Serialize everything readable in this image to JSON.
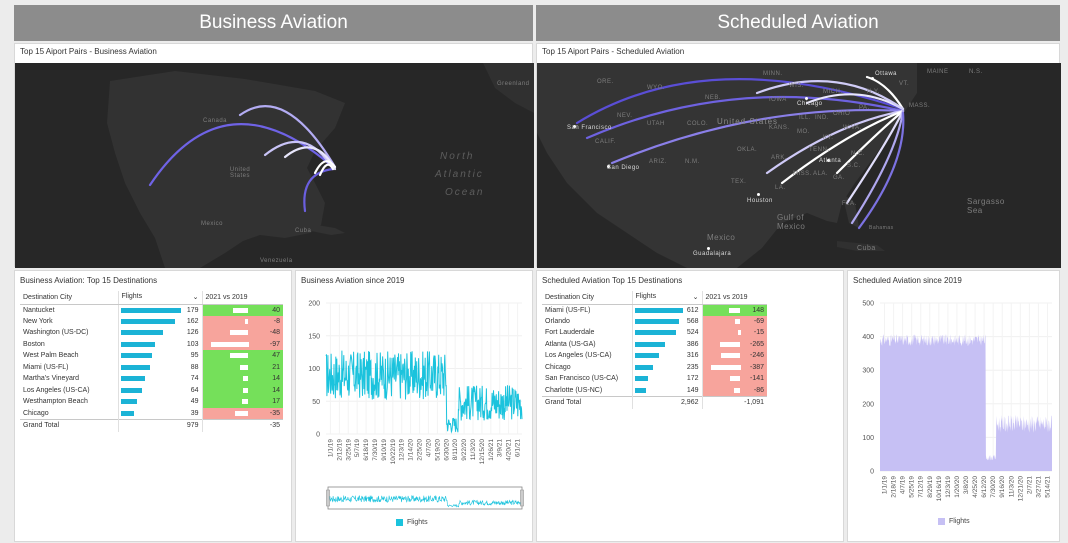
{
  "banners": {
    "left": "Business Aviation",
    "right": "Scheduled Aviation"
  },
  "maps": {
    "left": {
      "title": "Top 15 Aiport Pairs - Business Aviation",
      "labels": [
        "Canada",
        "United States",
        "Mexico",
        "Cuba",
        "North",
        "Atlantic",
        "Ocean",
        "Greenland",
        "Venezuela"
      ]
    },
    "right": {
      "title": "Top 15 Aiport Pairs - Scheduled Aviation",
      "labels": [
        "United States",
        "Mexico",
        "Gulf of Mexico",
        "Sargasso Sea",
        "Cuba",
        "Bahamas",
        "ORE.",
        "WYO.",
        "NEB.",
        "IOWA",
        "NEV.",
        "UTAH",
        "COLO.",
        "KANS.",
        "MO.",
        "CALIF.",
        "ARIZ.",
        "N.M.",
        "OKLA.",
        "ARK.",
        "TEX.",
        "LA.",
        "MISS.",
        "ALA.",
        "GA.",
        "S.C.",
        "N.C.",
        "TENN.",
        "KY.",
        "W.VA.",
        "OHIO",
        "IND.",
        "ILL.",
        "PA.",
        "N.Y.",
        "MAINE",
        "MASS.",
        "N.S.",
        "VT.",
        "MICH.",
        "WIS.",
        "MINN.",
        "FLA."
      ],
      "cities": [
        "Ottawa",
        "Chicago",
        "San Francisco",
        "San Diego",
        "Atlanta",
        "Houston",
        "Guadalajara"
      ]
    }
  },
  "business_table": {
    "title": "Business Aviation: Top 15 Destinations",
    "headers": [
      "Destination City",
      "Flights",
      "2021 vs 2019"
    ],
    "sort_icon": "chevron-down-icon",
    "rows": [
      {
        "city": "Nantucket",
        "flights": 179,
        "vs": 40
      },
      {
        "city": "New York",
        "flights": 162,
        "vs": -8
      },
      {
        "city": "Washington (US-DC)",
        "flights": 126,
        "vs": -48
      },
      {
        "city": "Boston",
        "flights": 103,
        "vs": -97
      },
      {
        "city": "West Palm Beach",
        "flights": 95,
        "vs": 47
      },
      {
        "city": "Miami (US-FL)",
        "flights": 88,
        "vs": 21
      },
      {
        "city": "Martha's Vineyard",
        "flights": 74,
        "vs": 14
      },
      {
        "city": "Los Angeles (US-CA)",
        "flights": 64,
        "vs": 14
      },
      {
        "city": "Westhampton Beach",
        "flights": 49,
        "vs": 17
      },
      {
        "city": "Chicago",
        "flights": 39,
        "vs": -35
      }
    ],
    "total_label": "Grand Total",
    "total_flights": 979,
    "total_vs": -35
  },
  "scheduled_table": {
    "title": "Scheduled Aviation Top 15 Destinations",
    "headers": [
      "Destination City",
      "Flights",
      "2021 vs 2019"
    ],
    "sort_icon": "chevron-down-icon",
    "rows": [
      {
        "city": "Miami (US-FL)",
        "flights": 612,
        "vs": 148
      },
      {
        "city": "Orlando",
        "flights": 568,
        "vs": -69
      },
      {
        "city": "Fort Lauderdale",
        "flights": 524,
        "vs": -15
      },
      {
        "city": "Atlanta (US-GA)",
        "flights": 386,
        "vs": -265
      },
      {
        "city": "Los Angeles (US-CA)",
        "flights": 316,
        "vs": -246
      },
      {
        "city": "Chicago",
        "flights": 235,
        "vs": -387
      },
      {
        "city": "San Francisco (US-CA)",
        "flights": 172,
        "vs": -141
      },
      {
        "city": "Charlotte (US-NC)",
        "flights": 149,
        "vs": -86
      }
    ],
    "total_label": "Grand Total",
    "total_flights": "2,962",
    "total_vs": "-1,091"
  },
  "colors": {
    "business": "#1bc3dd",
    "scheduled": "#c6c0f4",
    "positive": "#75e05a",
    "negative": "#f7a49c"
  },
  "chart_data": [
    {
      "type": "line",
      "title": "Business Aviation since 2019",
      "ylim": [
        0,
        200
      ],
      "yticks": [
        0,
        50,
        100,
        150,
        200
      ],
      "x_ticks": [
        "1/1/19",
        "2/12/19",
        "3/25/19",
        "5/7/19",
        "6/18/19",
        "7/30/19",
        "9/10/19",
        "10/22/19",
        "12/3/19",
        "1/14/20",
        "2/25/20",
        "4/7/20",
        "5/19/20",
        "6/30/20",
        "8/11/20",
        "9/22/20",
        "11/3/20",
        "12/15/20",
        "1/26/21",
        "3/9/21",
        "4/20/21",
        "6/1/21"
      ],
      "series": [
        {
          "name": "Flights",
          "segments": [
            {
              "x_range": [
                "1/1/19",
                "3/10/20"
              ],
              "approx_min": 55,
              "approx_max": 130,
              "approx_mean": 90
            },
            {
              "x_range": [
                "3/10/20",
                "4/20/20"
              ],
              "approx_min": 5,
              "approx_max": 30,
              "approx_mean": 15
            },
            {
              "x_range": [
                "4/20/20",
                "6/1/21"
              ],
              "approx_min": 25,
              "approx_max": 80,
              "approx_mean": 48
            }
          ]
        }
      ],
      "legend": "bottom"
    },
    {
      "type": "area",
      "title": "Scheduled Aviation since 2019",
      "ylim": [
        0,
        500
      ],
      "yticks": [
        0,
        100,
        200,
        300,
        400,
        500
      ],
      "x_ticks": [
        "1/1/19",
        "2/18/19",
        "4/7/19",
        "5/25/19",
        "7/12/19",
        "8/29/19",
        "10/16/19",
        "12/3/19",
        "1/20/20",
        "3/8/20",
        "4/25/20",
        "6/12/20",
        "7/30/20",
        "9/16/20",
        "11/3/20",
        "12/21/20",
        "2/7/21",
        "3/27/21",
        "5/14/21"
      ],
      "series": [
        {
          "name": "Flights",
          "segments": [
            {
              "x_range": [
                "1/1/19",
                "3/15/20"
              ],
              "approx_min": 360,
              "approx_max": 420,
              "approx_mean": 390
            },
            {
              "x_range": [
                "3/15/20",
                "5/1/20"
              ],
              "approx_min": 30,
              "approx_max": 60,
              "approx_mean": 40
            },
            {
              "x_range": [
                "5/1/20",
                "6/1/21"
              ],
              "approx_min": 100,
              "approx_max": 190,
              "approx_mean": 140
            }
          ]
        }
      ],
      "legend": "bottom"
    }
  ]
}
